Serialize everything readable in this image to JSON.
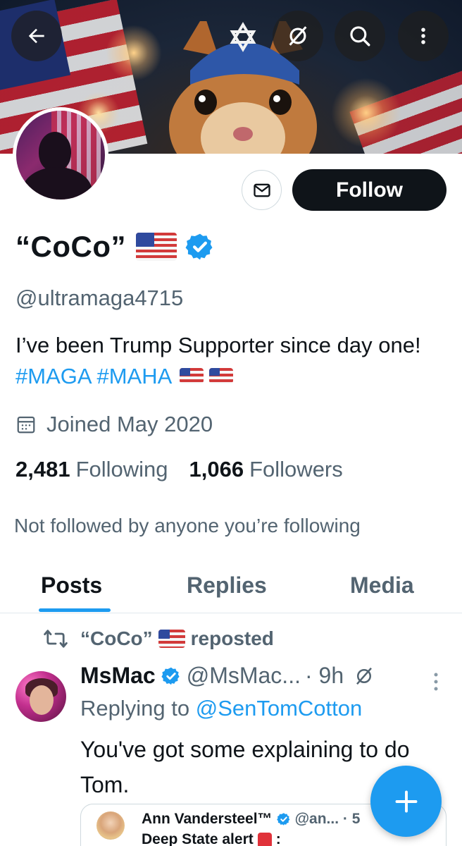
{
  "header": {
    "back_icon": "arrow-left-icon",
    "grok_icon": "grok-icon",
    "search_icon": "search-icon",
    "more_icon": "more-vertical-icon"
  },
  "profile": {
    "display_name": "“CoCo”",
    "handle": "@ultramaga4715",
    "bio_text": "I’ve been Trump Supporter since day one! ",
    "bio_tag1": "#MAGA",
    "bio_tag2": "#MAHA",
    "joined": "Joined May 2020",
    "following_count": "2,481",
    "following_label": "Following",
    "followers_count": "1,066",
    "followers_label": "Followers",
    "not_followed": "Not followed by anyone you’re following",
    "follow_label": "Follow",
    "message_icon": "mail-icon"
  },
  "tabs": [
    {
      "label": "Posts",
      "active": true
    },
    {
      "label": "Replies",
      "active": false
    },
    {
      "label": "Media",
      "active": false
    }
  ],
  "post": {
    "repost_name": "“CoCo”",
    "repost_label": "reposted",
    "author": "MsMac",
    "author_handle": "@MsMac...",
    "time": "· 9h",
    "replying_prefix": "Replying to ",
    "replying_to": "@SenTomCotton",
    "text": "You've got some explaining to do Tom.",
    "quote": {
      "author": "Ann Vandersteel™",
      "handle": "@an... · 5",
      "text": "Deep State alert",
      "text_suffix": ":"
    }
  },
  "colors": {
    "accent": "#1d9bf0",
    "primary_text": "#0f1419",
    "secondary_text": "#536471"
  },
  "fab_icon": "plus-icon"
}
